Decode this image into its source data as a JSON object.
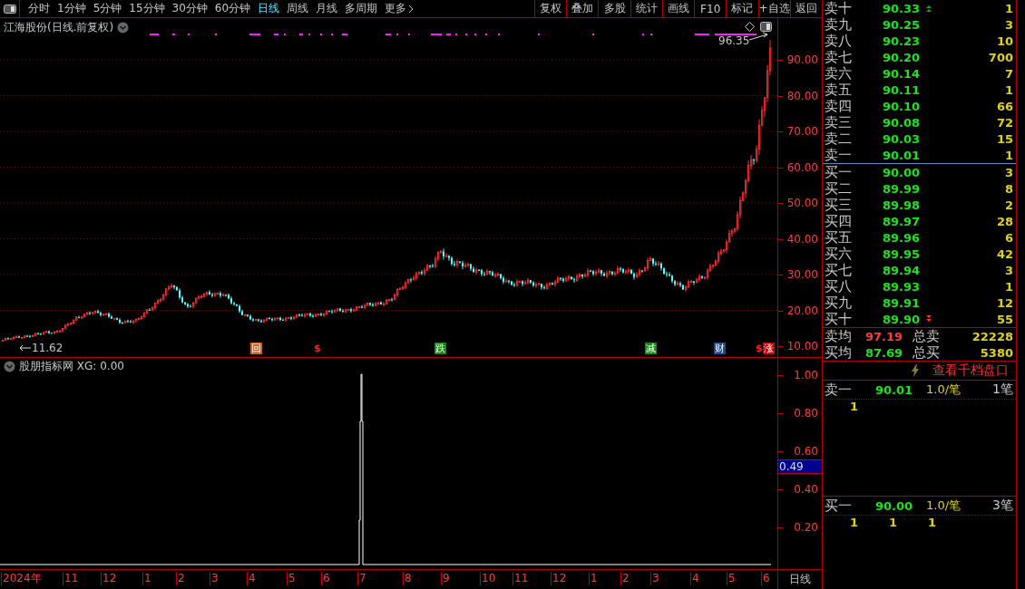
{
  "toolbar": {
    "periods": [
      {
        "label": "分时",
        "selected": false
      },
      {
        "label": "1分钟",
        "selected": false
      },
      {
        "label": "5分钟",
        "selected": false
      },
      {
        "label": "15分钟",
        "selected": false
      },
      {
        "label": "30分钟",
        "selected": false
      },
      {
        "label": "60分钟",
        "selected": false
      },
      {
        "label": "日线",
        "selected": true
      },
      {
        "label": "周线",
        "selected": false
      },
      {
        "label": "月线",
        "selected": false
      },
      {
        "label": "多周期",
        "selected": false
      },
      {
        "label": "更多",
        "selected": false
      }
    ],
    "buttons": [
      "复权",
      "叠加",
      "多股",
      "统计",
      "画线",
      "F10",
      "标记",
      "+自选",
      "返回"
    ]
  },
  "main_chart": {
    "title": "江海股份(日线.前复权)",
    "high_label": "96.35",
    "low_label": "11.62",
    "price_ticks": [
      "90.00",
      "80.00",
      "70.00",
      "60.00",
      "50.00",
      "40.00",
      "30.00",
      "20.00",
      "10.00"
    ],
    "event_markers": [
      {
        "label": "回",
        "kind": "badge",
        "color": "#c8641e"
      },
      {
        "label": "$",
        "kind": "text",
        "color": "#ff2020"
      },
      {
        "label": "跌",
        "kind": "badge",
        "color": "#108a10"
      },
      {
        "label": "减",
        "kind": "badge",
        "color": "#108a10"
      },
      {
        "label": "财",
        "kind": "badge",
        "color": "#1a4c8c"
      },
      {
        "label": "$",
        "kind": "text",
        "color": "#ff2020"
      },
      {
        "label": "涨",
        "kind": "badge",
        "color": "#c00000"
      }
    ]
  },
  "indicator": {
    "title": "股朋指标网 XG: 0.00",
    "ticks": [
      "1.00",
      "0.80",
      "0.60",
      "0.40",
      "0.20"
    ],
    "current_value": "0.49"
  },
  "date_axis": {
    "labels": [
      "2024年",
      "11",
      "12",
      "1",
      "2",
      "3",
      "4",
      "5",
      "6",
      "7",
      "8",
      "9",
      "10",
      "11",
      "12",
      "1",
      "2",
      "3",
      "4",
      "5",
      "6"
    ],
    "period": "日线"
  },
  "order_book": {
    "asks": [
      {
        "label": "卖十",
        "price": "90.33",
        "volume": "1",
        "kind": "arrow-up"
      },
      {
        "label": "卖九",
        "price": "90.25",
        "volume": "3"
      },
      {
        "label": "卖八",
        "price": "90.23",
        "volume": "10"
      },
      {
        "label": "卖七",
        "price": "90.20",
        "volume": "700"
      },
      {
        "label": "卖六",
        "price": "90.14",
        "volume": "7"
      },
      {
        "label": "卖五",
        "price": "90.11",
        "volume": "1"
      },
      {
        "label": "卖四",
        "price": "90.10",
        "volume": "66"
      },
      {
        "label": "卖三",
        "price": "90.08",
        "volume": "72"
      },
      {
        "label": "卖二",
        "price": "90.03",
        "volume": "15"
      },
      {
        "label": "卖一",
        "price": "90.01",
        "volume": "1"
      }
    ],
    "bids": [
      {
        "label": "买一",
        "price": "90.00",
        "volume": "3"
      },
      {
        "label": "买二",
        "price": "89.99",
        "volume": "8"
      },
      {
        "label": "买三",
        "price": "89.98",
        "volume": "2"
      },
      {
        "label": "买四",
        "price": "89.97",
        "volume": "28"
      },
      {
        "label": "买五",
        "price": "89.96",
        "volume": "6"
      },
      {
        "label": "买六",
        "price": "89.95",
        "volume": "42"
      },
      {
        "label": "买七",
        "price": "89.94",
        "volume": "3"
      },
      {
        "label": "买八",
        "price": "89.93",
        "volume": "1"
      },
      {
        "label": "买九",
        "price": "89.91",
        "volume": "12"
      },
      {
        "label": "买十",
        "price": "89.90",
        "volume": "55",
        "kind": "arrow-down"
      }
    ],
    "summary": [
      {
        "label": "卖均",
        "price": "97.19",
        "color": "#ff3c3c",
        "total_label": "总卖",
        "total": "22228"
      },
      {
        "label": "买均",
        "price": "87.69",
        "color": "#20e020",
        "total_label": "总买",
        "total": "5380"
      }
    ],
    "depth_link": "查看千档盘口",
    "queues": [
      {
        "label": "卖一",
        "price": "90.01",
        "per_order": "1.0/笔",
        "orders": "1笔",
        "items": [
          "1"
        ]
      },
      {
        "label": "买一",
        "price": "90.00",
        "per_order": "1.0/笔",
        "orders": "3笔",
        "items": [
          "1",
          "1",
          "1"
        ]
      }
    ]
  }
}
